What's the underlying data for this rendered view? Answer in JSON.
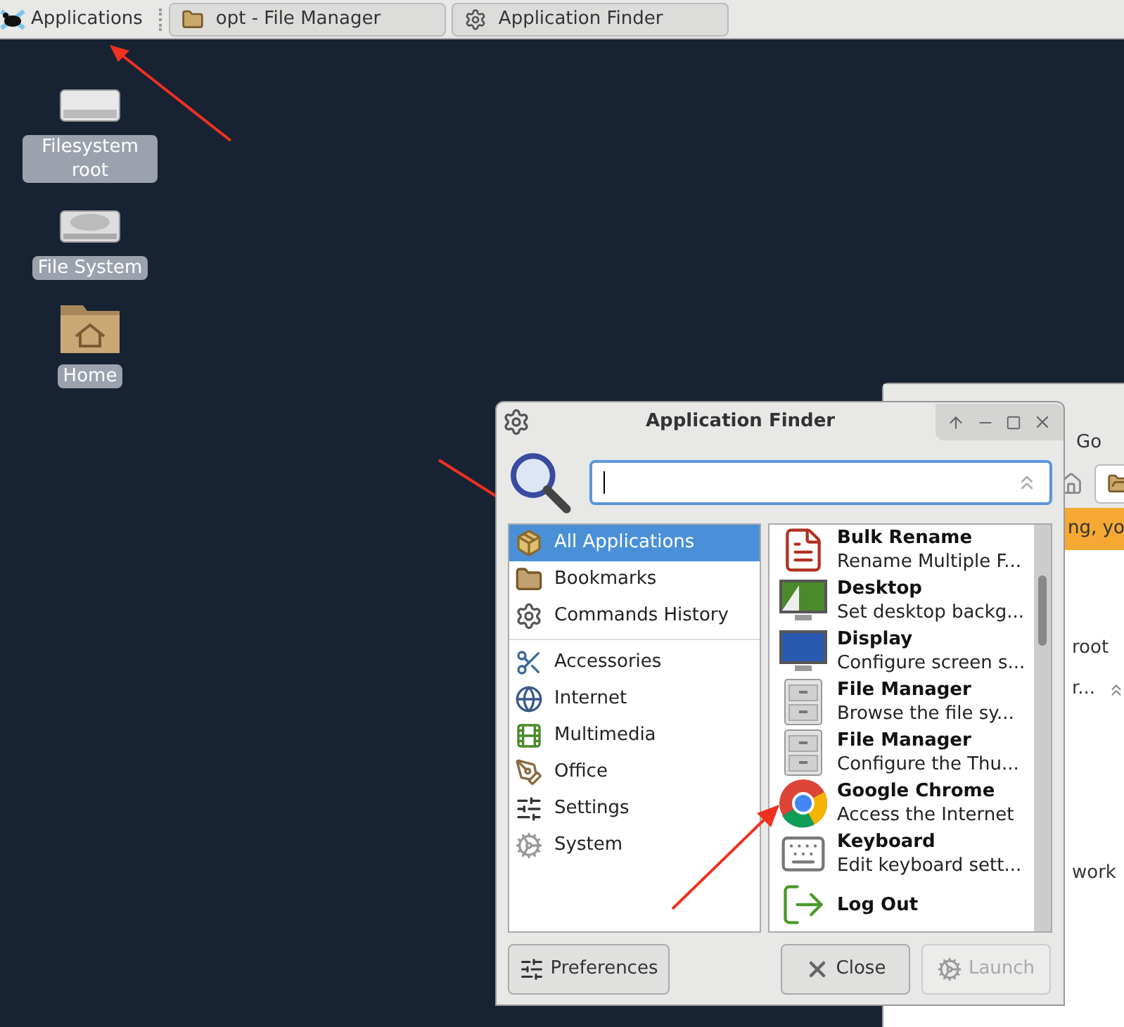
{
  "taskbar": {
    "items": [
      {
        "label": "Applications",
        "kind": "menu"
      },
      {
        "label": "opt - File Manager",
        "kind": "folder"
      },
      {
        "label": "Application Finder",
        "kind": "gears"
      }
    ]
  },
  "desktop_icons": [
    {
      "label": "Filesystem root",
      "kind": "drive"
    },
    {
      "label": "File System",
      "kind": "disk"
    },
    {
      "label": "Home",
      "kind": "home"
    }
  ],
  "background_window": {
    "menu": "Go",
    "banner": "ng, yo",
    "items": [
      "root",
      "r...",
      "work"
    ]
  },
  "dialog": {
    "title": "Application Finder",
    "categories": [
      {
        "items": [
          {
            "label": "All Applications",
            "kind": "all",
            "selected": true
          },
          {
            "label": "Bookmarks",
            "kind": "bookmarks",
            "selected": false
          },
          {
            "label": "Commands History",
            "kind": "history",
            "selected": false
          }
        ]
      },
      {
        "items": [
          {
            "label": "Accessories",
            "kind": "accessories",
            "selected": false
          },
          {
            "label": "Internet",
            "kind": "internet",
            "selected": false
          },
          {
            "label": "Multimedia",
            "kind": "multimedia",
            "selected": false
          },
          {
            "label": "Office",
            "kind": "office",
            "selected": false
          },
          {
            "label": "Settings",
            "kind": "settings",
            "selected": false
          },
          {
            "label": "System",
            "kind": "system",
            "selected": false
          }
        ]
      }
    ],
    "apps": [
      {
        "name": "Bulk Rename",
        "description": "Rename Multiple F...",
        "kind": "rename"
      },
      {
        "name": "Desktop",
        "description": "Set desktop backg...",
        "kind": "desktop"
      },
      {
        "name": "Display",
        "description": "Configure screen s...",
        "kind": "display"
      },
      {
        "name": "File Manager",
        "description": "Browse the file sy...",
        "kind": "cabinet"
      },
      {
        "name": "File Manager",
        "description": "Configure the Thu...",
        "kind": "cabinet"
      },
      {
        "name": "Google Chrome",
        "description": "Access the Internet",
        "kind": "chrome"
      },
      {
        "name": "Keyboard",
        "description": "Edit keyboard sett...",
        "kind": "keyboard"
      },
      {
        "name": "Log Out",
        "kind": "logout"
      }
    ],
    "buttons": [
      {
        "label": "Preferences",
        "kind": "preferences",
        "disabled": false
      },
      {
        "label": "Close",
        "kind": "close",
        "disabled": false
      },
      {
        "label": "Launch",
        "kind": "launch",
        "disabled": true
      }
    ]
  }
}
